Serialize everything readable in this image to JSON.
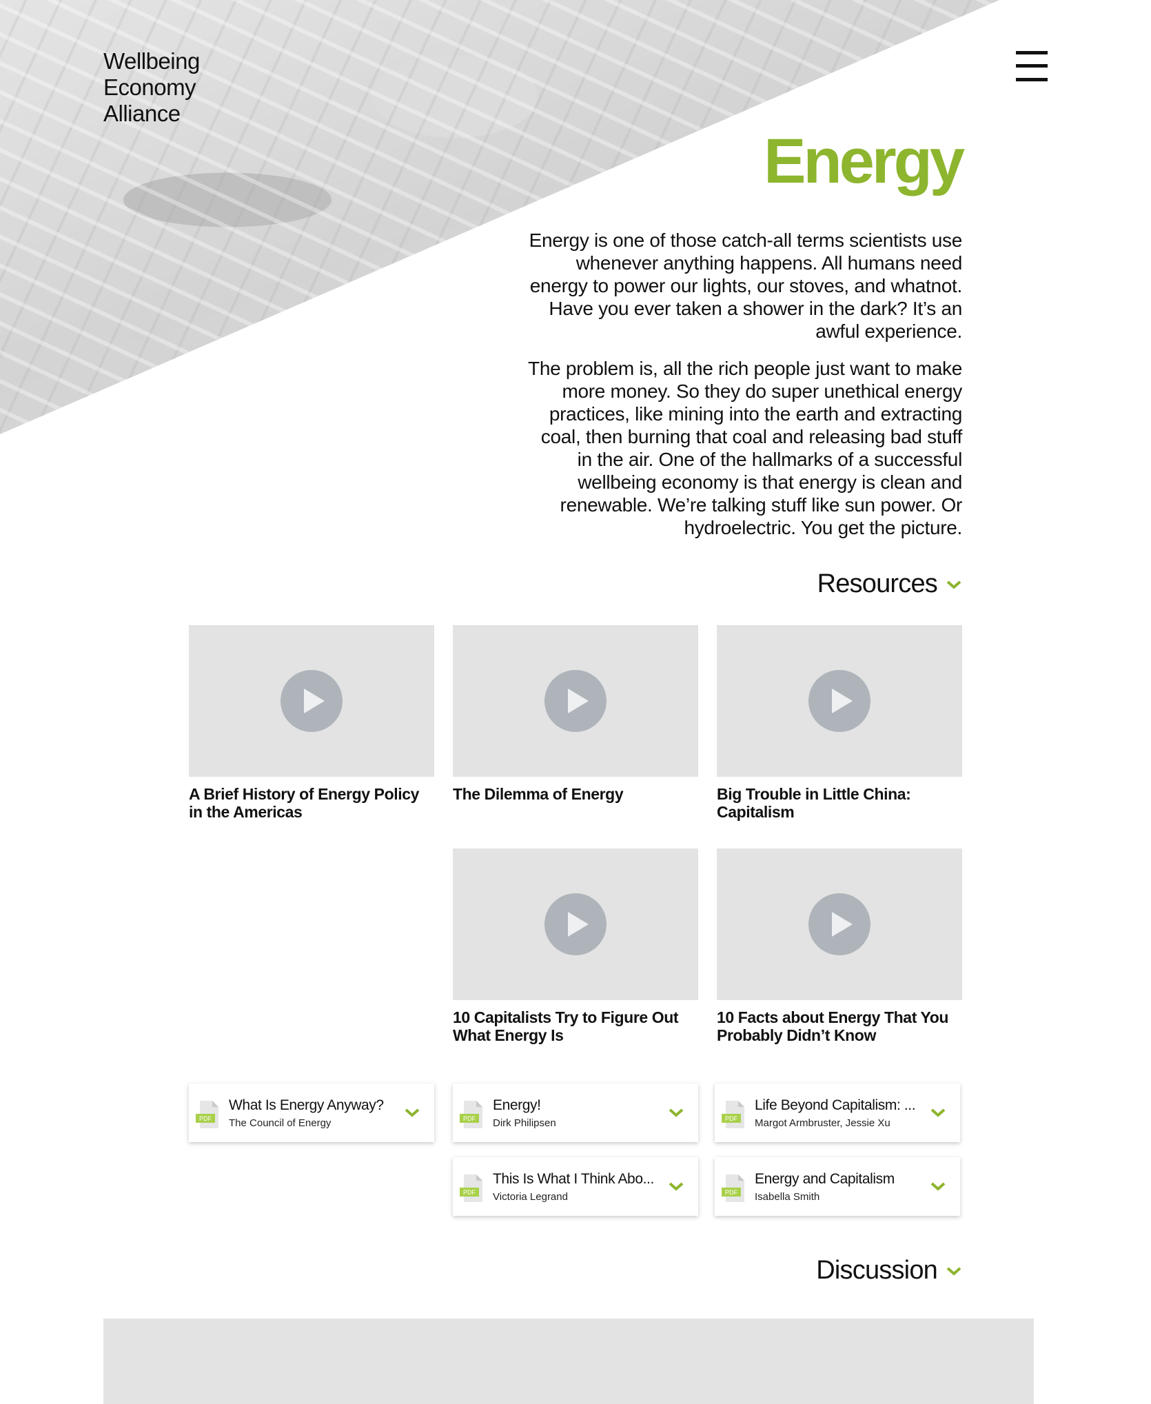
{
  "header": {
    "logo_lines": [
      "Wellbeing",
      "Economy",
      "Alliance"
    ],
    "menu_icon": "hamburger-menu-icon"
  },
  "page": {
    "title": "Energy",
    "intro_paragraphs": [
      "Energy is one of those catch-all terms scientists use whenever anything happens. All humans need energy to power our lights, our stoves, and whatnot. Have you ever taken a shower in the dark? It’s an awful experience.",
      "The problem is, all the rich people just want to make more money. So they do super unethical energy practices, like mining into the earth and extracting coal, then burning that coal and releasing bad stuff in the air. One of the hallmarks of a successful wellbeing economy is that energy is clean and renewable. We’re talking stuff like sun power. Or hydroelectric. You get the picture."
    ]
  },
  "resources": {
    "heading": "Resources",
    "videos": [
      {
        "title": "A Brief History of Energy Policy in the Americas"
      },
      {
        "title": "The Dilemma of Energy"
      },
      {
        "title": "Big Trouble in Little China: Capitalism"
      },
      {
        "title": "10 Capitalists Try to Figure Out What Energy Is"
      },
      {
        "title": "10 Facts about Energy That You Probably Didn’t Know"
      }
    ],
    "documents": [
      {
        "title": "What Is Energy Anyway?",
        "author": "The Council of Energy",
        "badge": "PDF"
      },
      {
        "title": "Energy!",
        "author": "Dirk Philipsen",
        "badge": "PDF"
      },
      {
        "title": "Life Beyond Capitalism: ...",
        "author": "Margot Armbruster, Jessie Xu",
        "badge": "PDF"
      },
      {
        "title": "This Is What I Think Abo...",
        "author": "Victoria Legrand",
        "badge": "PDF"
      },
      {
        "title": "Energy and Capitalism",
        "author": "Isabella Smith",
        "badge": "PDF"
      }
    ]
  },
  "discussion": {
    "heading": "Discussion"
  },
  "colors": {
    "accent": "#8db52e",
    "thumb_bg": "#e3e3e3",
    "play_button": "#aeb4ba",
    "pdf_badge": "#a9d04a"
  }
}
